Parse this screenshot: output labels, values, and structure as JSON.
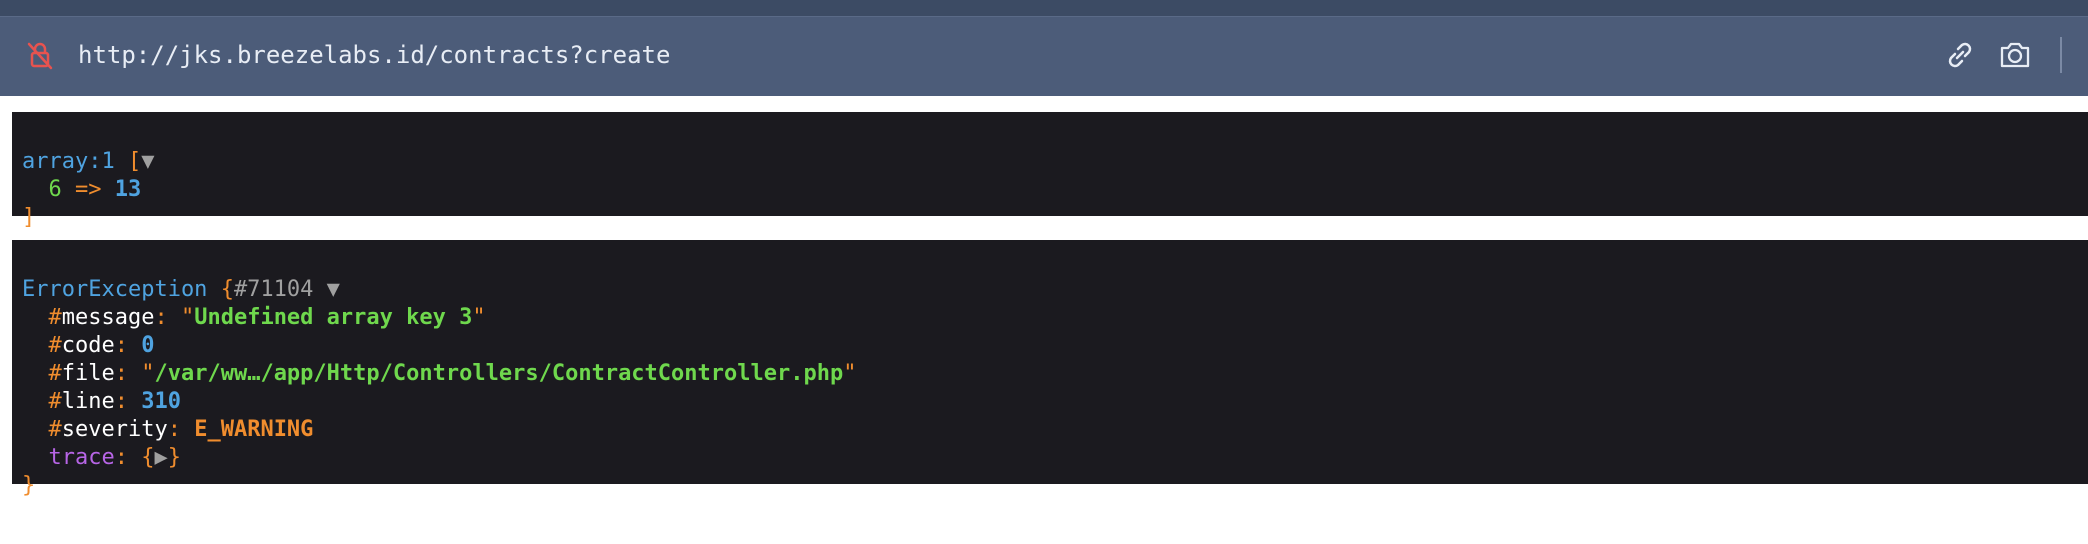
{
  "browser": {
    "url": "http://jks.breezelabs.id/contracts?create",
    "icons": {
      "lock": "lock-slash-icon",
      "link": "link-icon",
      "camera": "camera-icon"
    }
  },
  "dumps": [
    {
      "header": {
        "type": "array:1",
        "open": "[",
        "toggle": "▼"
      },
      "entries": [
        {
          "key": "6",
          "arrow": "=>",
          "value": "13"
        }
      ],
      "close": "]"
    },
    {
      "header": {
        "class": "ErrorException",
        "open": "{",
        "id": "#71104",
        "toggle": "▼"
      },
      "props": {
        "message": {
          "hash": "#",
          "name": "message",
          "colon": ":",
          "value": "Undefined array key 3"
        },
        "code": {
          "hash": "#",
          "name": "code",
          "colon": ":",
          "value": "0"
        },
        "file": {
          "hash": "#",
          "name": "file",
          "colon": ":",
          "value": "/var/ww…/app/Http/Controllers/ContractController.php"
        },
        "line": {
          "hash": "#",
          "name": "line",
          "colon": ":",
          "value": "310"
        },
        "severity": {
          "hash": "#",
          "name": "severity",
          "colon": ":",
          "value": "E_WARNING"
        },
        "trace": {
          "name": "trace",
          "colon": ":",
          "open": "{",
          "toggle": "▶",
          "close": "}"
        }
      },
      "close": "}"
    }
  ],
  "colors": {
    "url_bar_bg": "#4c5c79",
    "dump_bg": "#1b1a1f",
    "type_blue": "#4fa3e0",
    "punct_orange": "#f08d2e",
    "string_green": "#6fd84d",
    "trace_purple": "#b765e6"
  }
}
